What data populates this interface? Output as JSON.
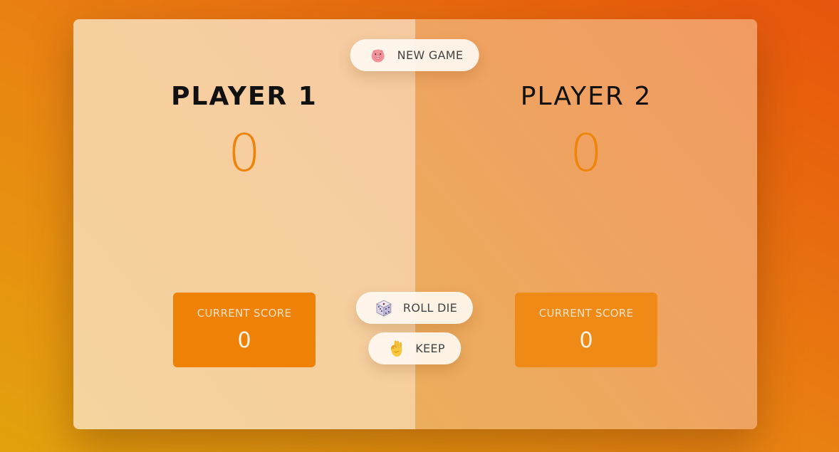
{
  "players": [
    {
      "name": "PLAYER 1",
      "total_score": "0",
      "current_label": "CURRENT SCORE",
      "current_score": "0",
      "active": true
    },
    {
      "name": "PLAYER 2",
      "total_score": "0",
      "current_label": "CURRENT SCORE",
      "current_score": "0",
      "active": false
    }
  ],
  "buttons": {
    "new_game": {
      "label": "NEW GAME",
      "icon": "pig-icon"
    },
    "roll_die": {
      "label": "ROLL DIE",
      "icon": "dice-icon"
    },
    "keep": {
      "label": "KEEP",
      "icon": "ok-hand-icon"
    }
  },
  "colors": {
    "accent": "#ee8409",
    "background_top": "#e8540c",
    "background_bottom": "#e3a20d"
  }
}
